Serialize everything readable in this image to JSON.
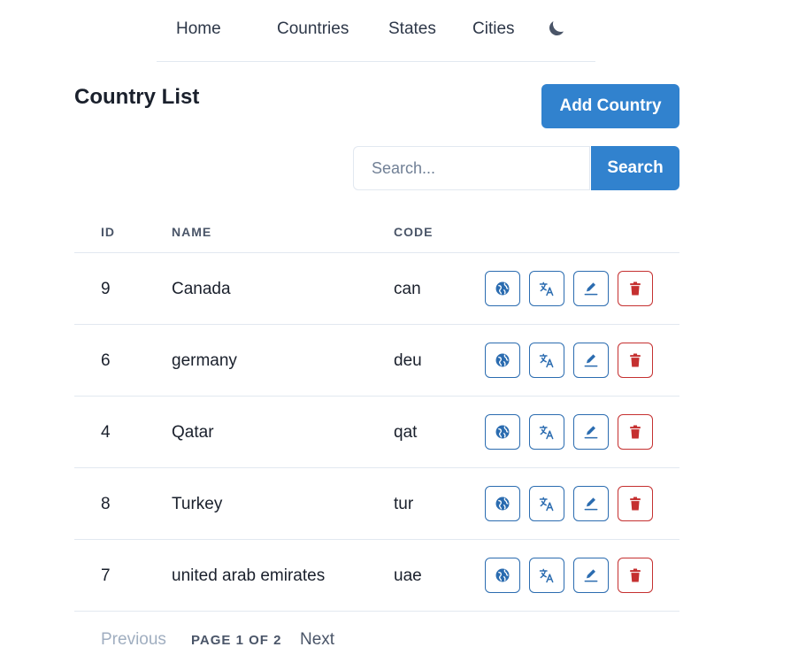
{
  "nav": {
    "home": "Home",
    "countries": "Countries",
    "states": "States",
    "cities": "Cities",
    "theme_icon": "moon-icon"
  },
  "page": {
    "title": "Country List",
    "add_button": "Add Country"
  },
  "search": {
    "placeholder": "Search...",
    "value": "",
    "button": "Search"
  },
  "table": {
    "headers": [
      "ID",
      "NAME",
      "CODE"
    ],
    "rows": [
      {
        "id": "9",
        "name": "Canada",
        "code": "can"
      },
      {
        "id": "6",
        "name": "germany",
        "code": "deu"
      },
      {
        "id": "4",
        "name": "Qatar",
        "code": "qat"
      },
      {
        "id": "8",
        "name": "Turkey",
        "code": "tur"
      },
      {
        "id": "7",
        "name": "united arab emirates",
        "code": "uae"
      }
    ],
    "row_actions": [
      "globe-icon",
      "translate-icon",
      "edit-icon",
      "trash-icon"
    ]
  },
  "pagination": {
    "previous": "Previous",
    "info": "PAGE 1 OF 2",
    "next": "Next"
  },
  "colors": {
    "primary": "#3182ce",
    "action_blue": "#2b6cb0",
    "danger": "#c53030",
    "muted": "#a0aec0"
  }
}
